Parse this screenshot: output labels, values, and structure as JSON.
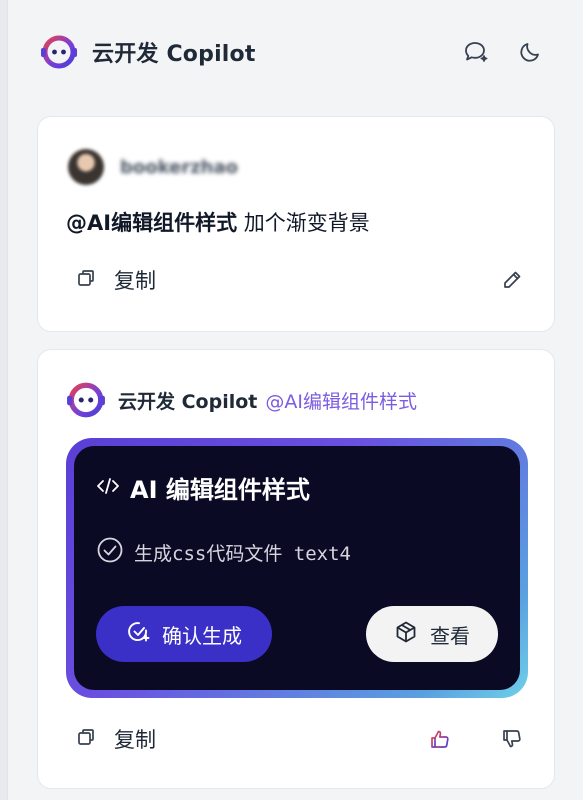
{
  "header": {
    "title": "云开发 Copilot",
    "icons": [
      "copilot-logo-icon",
      "chat-sparkle-icon",
      "moon-icon"
    ]
  },
  "user_message": {
    "username": "bookerzhao",
    "mention": "@AI编辑组件样式",
    "text": " 加个渐变背景",
    "copy_label": "复制",
    "icons": [
      "copy-icon",
      "edit-icon"
    ]
  },
  "bot_message": {
    "name": "云开发 Copilot",
    "mention": "@AI编辑组件样式",
    "task": {
      "title": "AI 编辑组件样式",
      "step": "生成css代码文件 text4",
      "confirm_label": "确认生成",
      "view_label": "查看"
    },
    "copy_label": "复制",
    "icons": [
      "copy-icon",
      "thumbs-up-icon",
      "thumbs-down-icon"
    ]
  },
  "colors": {
    "accent_purple": "#3a2fc7",
    "mention_purple": "#7c5ce0",
    "task_bg": "#0b0a24",
    "logo_purple": "#5b3fd6",
    "logo_red": "#e8404f"
  }
}
